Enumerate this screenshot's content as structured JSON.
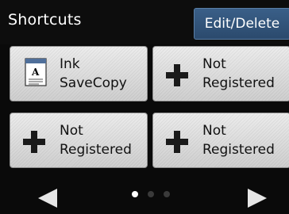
{
  "header": {
    "title": "Shortcuts",
    "edit_button_label": "Edit/Delete"
  },
  "tiles": [
    {
      "label": "Ink\nSaveCopy",
      "icon": "document-icon"
    },
    {
      "label": "Not\nRegistered",
      "icon": "plus-icon"
    },
    {
      "label": "Not\nRegistered",
      "icon": "plus-icon"
    },
    {
      "label": "Not\nRegistered",
      "icon": "plus-icon"
    }
  ],
  "pagination": {
    "current_page": 1,
    "total_pages": 3
  },
  "colors": {
    "accent": "#2f4f74",
    "dot_active": "#ffffff",
    "dot_inactive": "#3a3a3a"
  }
}
